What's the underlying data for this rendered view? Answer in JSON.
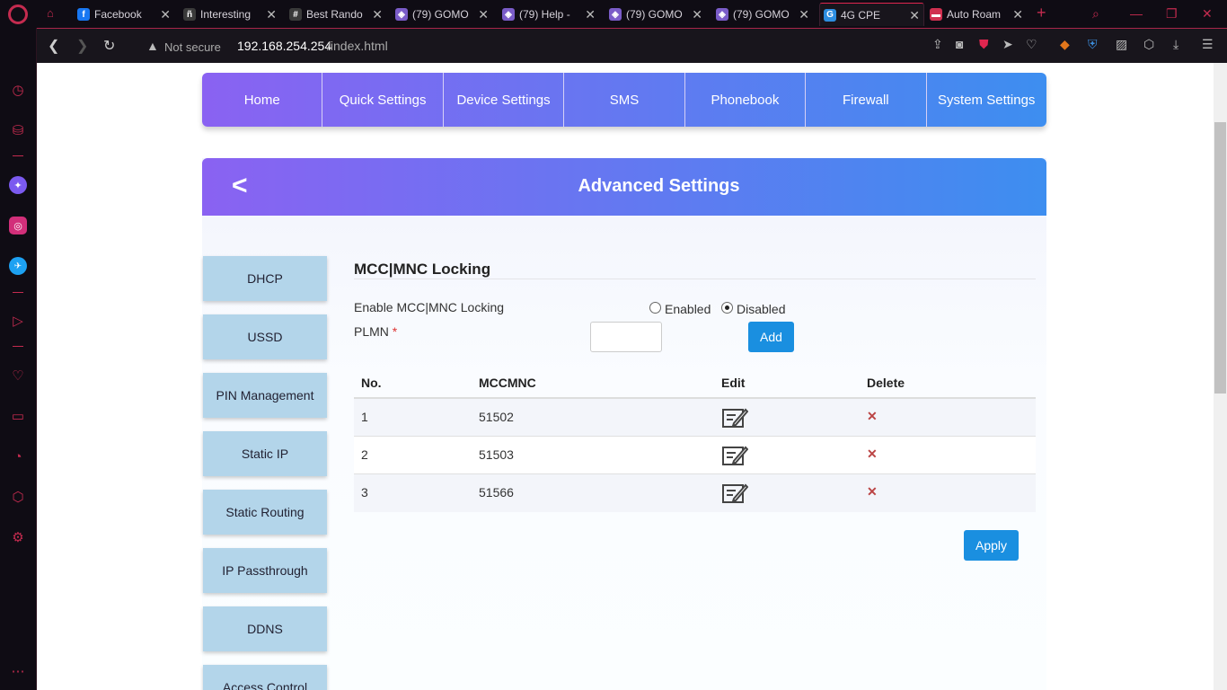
{
  "browser": {
    "tabs": [
      {
        "label": "Facebook",
        "favicon": "facebook-icon",
        "color": "#1877f2",
        "glyph": "f"
      },
      {
        "label": "Interesting",
        "favicon": "person-icon",
        "color": "#3a3a3a",
        "glyph": "ñ"
      },
      {
        "label": "Best Rando",
        "favicon": "hash-icon",
        "color": "#3a3a3a",
        "glyph": "#"
      },
      {
        "label": "(79) GOMO",
        "favicon": "cube-icon",
        "color": "#7a5cc8",
        "glyph": "◈"
      },
      {
        "label": "(79) Help -",
        "favicon": "cube-icon",
        "color": "#7a5cc8",
        "glyph": "◈"
      },
      {
        "label": "(79) GOMO",
        "favicon": "cube-icon",
        "color": "#7a5cc8",
        "glyph": "◈"
      },
      {
        "label": "(79) GOMO",
        "favicon": "cube-icon",
        "color": "#7a5cc8",
        "glyph": "◈"
      },
      {
        "label": "4G CPE",
        "favicon": "globe-icon",
        "color": "#2d8ee0",
        "glyph": "G"
      },
      {
        "label": "Auto Roam",
        "favicon": "flag-icon",
        "color": "#d03050",
        "glyph": "▬"
      }
    ],
    "url": {
      "warning": "Not secure",
      "host": "192.168.254.254",
      "path": "/index.html"
    },
    "accent": "#c42b4f"
  },
  "menu": {
    "items": [
      "Home",
      "Quick Settings",
      "Device Settings",
      "SMS",
      "Phonebook",
      "Firewall",
      "System Settings"
    ]
  },
  "advanced": {
    "title": "Advanced Settings",
    "sidenav": [
      "DHCP",
      "USSD",
      "PIN Management",
      "Static IP",
      "Static Routing",
      "IP Passthrough",
      "DDNS",
      "Access Control"
    ]
  },
  "mcc": {
    "title": "MCC|MNC Locking",
    "enable_label": "Enable MCC|MNC Locking",
    "enabled_label": "Enabled",
    "disabled_label": "Disabled",
    "selected": "Disabled",
    "plmn_label": "PLMN",
    "required_mark": "*",
    "plmn_value": "",
    "add_label": "Add",
    "apply_label": "Apply",
    "table": {
      "headers": [
        "No.",
        "MCCMNC",
        "Edit",
        "Delete"
      ],
      "rows": [
        {
          "no": "1",
          "mccmnc": "51502"
        },
        {
          "no": "2",
          "mccmnc": "51503"
        },
        {
          "no": "3",
          "mccmnc": "51566"
        }
      ]
    }
  }
}
